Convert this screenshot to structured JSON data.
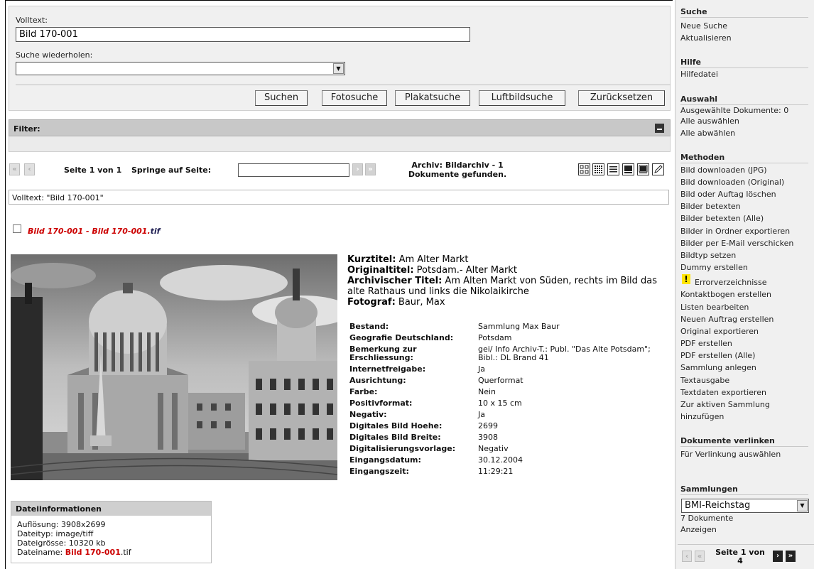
{
  "search": {
    "fulltext_label": "Volltext:",
    "fulltext_value": "Bild 170-001",
    "repeat_label": "Suche wiederholen:",
    "repeat_value": "",
    "buttons": [
      "Suchen",
      "Fotosuche",
      "Plakatsuche",
      "Luftbildsuche",
      "Zurücksetzen"
    ]
  },
  "filter": {
    "title": "Filter:"
  },
  "pagination": {
    "first": "«",
    "prev": "‹",
    "next": "›",
    "last": "»",
    "page_info": "Seite 1 von 1",
    "jump_label": "Springe auf Seite:",
    "jump_value": "",
    "archive_line1": "Archiv: Bildarchiv - 1",
    "archive_line2": "Dokumente gefunden.",
    "view_icons": [
      "thumbnail-grid-icon",
      "small-grid-icon",
      "list-icon",
      "detail-icon",
      "single-view-icon",
      "edit-pencil-icon"
    ]
  },
  "query": {
    "text": "Volltext: \"Bild 170-001\""
  },
  "result": {
    "title": "Bild 170-001 - Bild 170-001.",
    "title_ext": "tif",
    "kurztitel_label": "Kurztitel:",
    "kurztitel": " Am Alter Markt",
    "originaltitel_label": "Originaltitel:",
    "originaltitel": " Potsdam.- Alter Markt",
    "archivtitel_label": "Archivischer Titel:",
    "archivtitel": " Am Alten Markt von Süden, rechts im Bild das alte Rathaus und links die Nikolaikirche",
    "fotograf_label": "Fotograf:",
    "fotograf": " Baur, Max",
    "metadata": [
      {
        "key": "Bestand:",
        "value": "Sammlung Max Baur"
      },
      {
        "key": "Geografie Deutschland:",
        "value": "Potsdam"
      },
      {
        "key": "Bemerkung zur Erschliessung:",
        "value": "gei/ Info Archiv-T.: Publ. \"Das Alte Potsdam\"; Bibl.: DL Brand 41"
      },
      {
        "key": "Internetfreigabe:",
        "value": "Ja"
      },
      {
        "key": "Ausrichtung:",
        "value": "Querformat"
      },
      {
        "key": "Farbe:",
        "value": "Nein"
      },
      {
        "key": "Positivformat:",
        "value": "10 x 15 cm"
      },
      {
        "key": "Negativ:",
        "value": "Ja"
      },
      {
        "key": "Digitales Bild Hoehe:",
        "value": "2699"
      },
      {
        "key": "Digitales Bild Breite:",
        "value": "3908"
      },
      {
        "key": "Digitalisierungsvorlage:",
        "value": "Negativ"
      },
      {
        "key": "Eingangsdatum:",
        "value": "30.12.2004"
      },
      {
        "key": "Eingangszeit:",
        "value": "11:29:21"
      }
    ]
  },
  "fileinfo": {
    "title": "Dateiinformationen",
    "aufloesung": "Auflösung:  3908x2699",
    "dateityp": "Dateityp:  image/tiff",
    "dateigroesse": "Dateigrösse:  10320  kb",
    "dateiname_label": "Dateiname:  ",
    "dateiname_red": "Bild 170-001",
    "dateiname_ext": ".tif"
  },
  "sidebar": {
    "suche_head": "Suche",
    "suche_items": [
      "Neue Suche",
      "Aktualisieren"
    ],
    "hilfe_head": "Hilfe",
    "hilfe_items": [
      "Hilfedatei"
    ],
    "auswahl_head": "Auswahl",
    "auswahl_items": [
      "Ausgewählte Dokumente: 0",
      "Alle auswählen",
      "Alle abwählen"
    ],
    "methoden_head": "Methoden",
    "methoden_items": [
      "Bild downloaden (JPG)",
      "Bild downloaden (Original)",
      "Bild oder Auftag löschen",
      "Bilder betexten",
      "Bilder betexten (Alle)",
      "Bilder in Ordner exportieren",
      "Bilder per E-Mail verschicken",
      "Bildtyp setzen",
      "Dummy erstellen",
      "Errorverzeichnisse",
      "Kontaktbogen erstellen",
      "Listen bearbeiten",
      "Neuen Auftrag erstellen",
      "Original exportieren",
      "PDF erstellen",
      "PDF erstellen (Alle)",
      "Sammlung anlegen",
      "Textausgabe",
      "Textdaten exportieren",
      "Zur aktiven Sammlung",
      "hinzufügen"
    ],
    "warn_glyph": "!",
    "verlinken_head": "Dokumente verlinken",
    "verlinken_items": [
      "Für Verlinkung auswählen"
    ],
    "sammlungen_head": "Sammlungen",
    "sammlung_selected": "BMI-Reichstag",
    "sammlung_count": "7 Dokumente",
    "sammlung_show": "Anzeigen",
    "pg_text1": "Seite 1 von",
    "pg_text2": "4"
  },
  "colors": {
    "accent_red": "#cc0000",
    "panel_gray": "#f0f0f0",
    "header_gray": "#c8c8c8",
    "warn_yellow": "#ffe400"
  }
}
